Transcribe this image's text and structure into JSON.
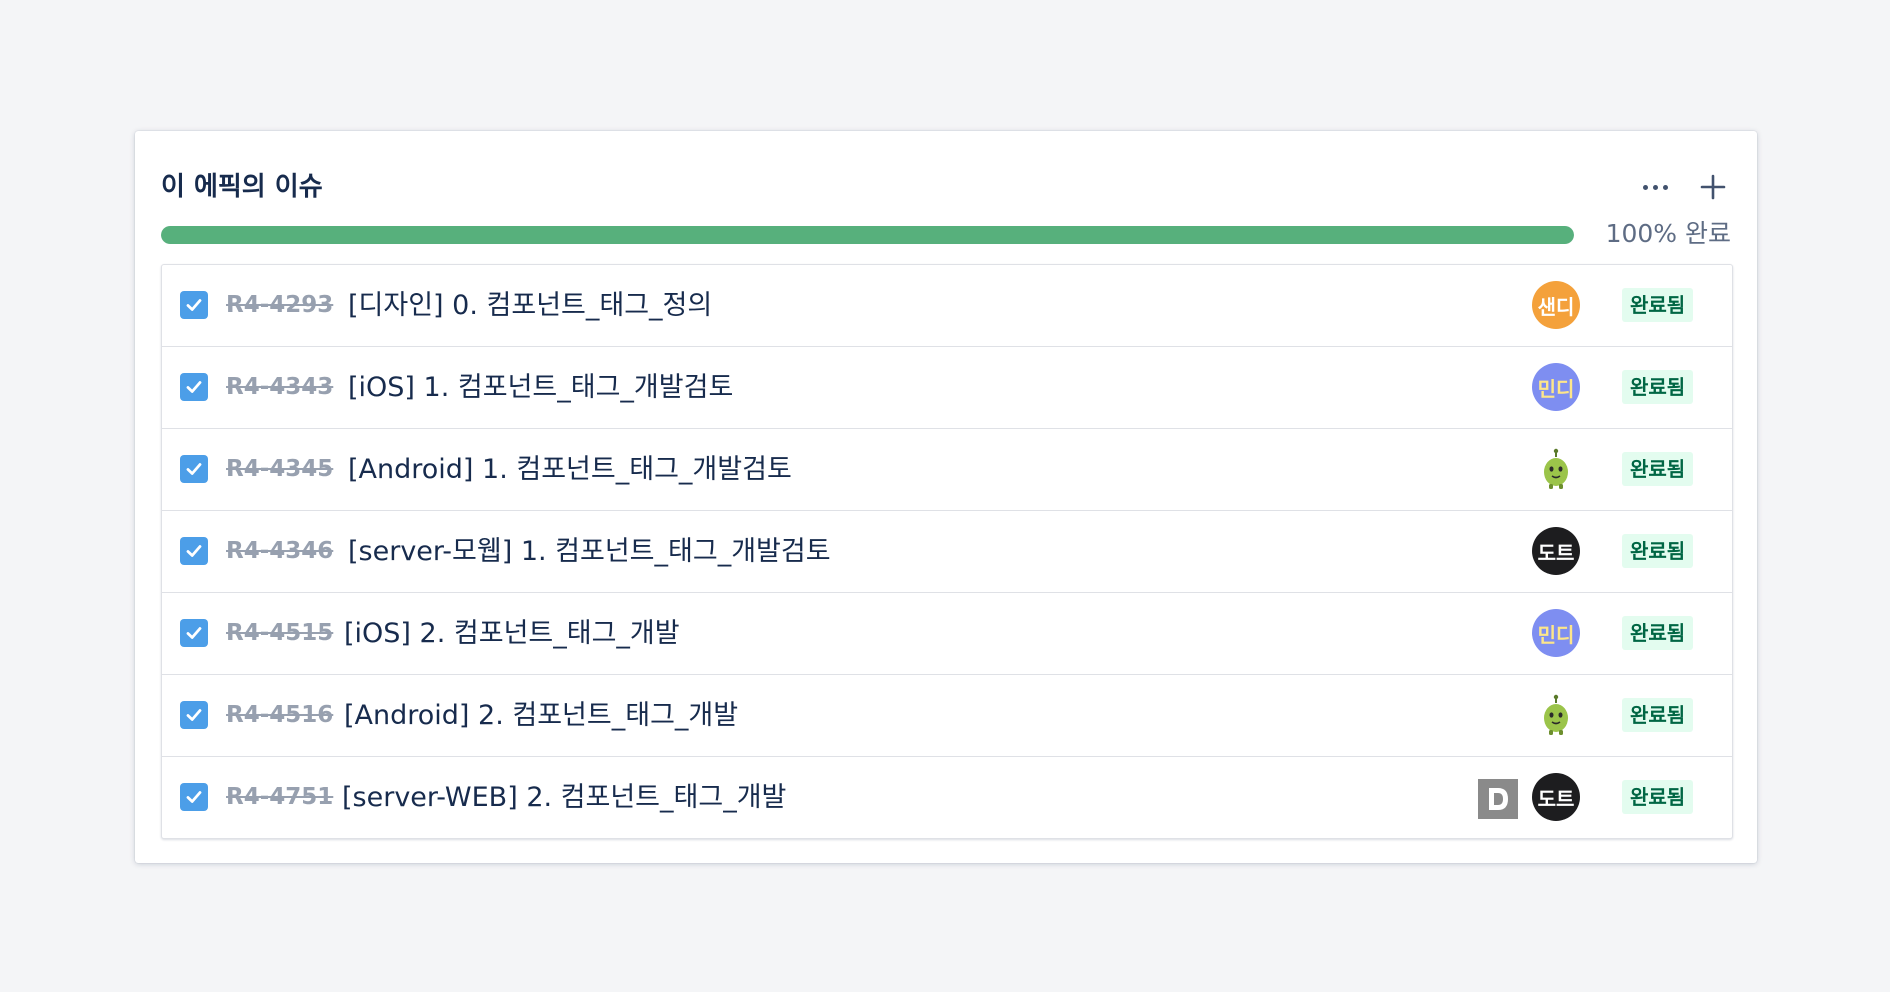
{
  "header": {
    "title": "이 에픽의 이슈",
    "more_icon": "more-horizontal-icon",
    "add_icon": "plus-icon"
  },
  "progress": {
    "percent": 100,
    "label": "100% 완료",
    "color": "#57b07c"
  },
  "colors": {
    "checkbox": "#4c9ee8",
    "status_bg": "#e3fcef",
    "status_text": "#006644"
  },
  "issues": [
    {
      "key": "R4-4293",
      "summary": "[디자인] 0. 컴포넌트_태그_정의",
      "assignee": "샌디",
      "status": "완료됨"
    },
    {
      "key": "R4-4343",
      "summary": "[iOS] 1. 컴포넌트_태그_개발검토",
      "assignee": "민디",
      "status": "완료됨"
    },
    {
      "key": "R4-4345",
      "summary": "[Android] 1. 컴포넌트_태그_개발검토",
      "assignee": "",
      "status": "완료됨"
    },
    {
      "key": "R4-4346",
      "summary": "[server-모웹] 1. 컴포넌트_태그_개발검토",
      "assignee": "도트",
      "status": "완료됨"
    },
    {
      "key": "R4-4515",
      "summary": "[iOS] 2. 컴포넌트_태그_개발",
      "assignee": "민디",
      "status": "완료됨"
    },
    {
      "key": "R4-4516",
      "summary": "[Android] 2. 컴포넌트_태그_개발",
      "assignee": "",
      "status": "완료됨"
    },
    {
      "key": "R4-4751",
      "summary": "[server-WEB] 2. 컴포넌트_태그_개발",
      "assignee": "도트",
      "status": "완료됨",
      "extra_icon": "D"
    }
  ]
}
